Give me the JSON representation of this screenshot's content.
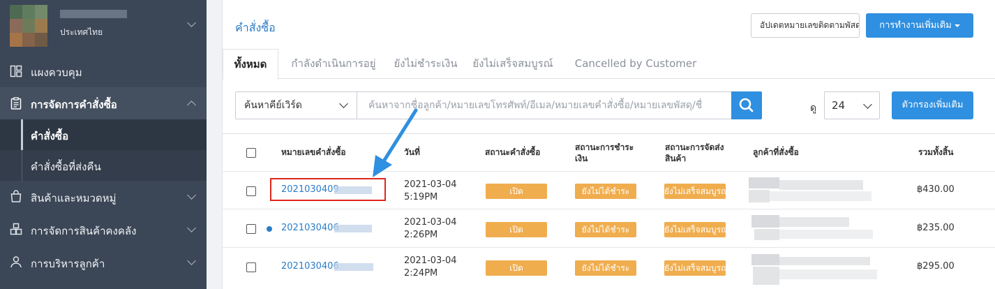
{
  "sidebar": {
    "store": {
      "country": "ประเทศไทย"
    },
    "items": [
      {
        "label": "แผงควบคุม"
      },
      {
        "label": "การจัดการคำสั่งซื้อ"
      },
      {
        "label": "คำสั่งซื้อ"
      },
      {
        "label": "คำสั่งซื้อที่ส่งคืน"
      },
      {
        "label": "สินค้าและหมวดหมู่"
      },
      {
        "label": "การจัดการสินค้าคงคลัง"
      },
      {
        "label": "การบริหารลูกค้า"
      }
    ]
  },
  "header": {
    "title": "คำสั่งซื้อ",
    "update_tracking_label": "อัปเดตหมายเลขติดตามพัสดุ",
    "more_actions_label": "การทำงานเพิ่มเติม"
  },
  "tabs": [
    {
      "label": "ทั้งหมด"
    },
    {
      "label": "กำลังดำเนินการอยู่"
    },
    {
      "label": "ยังไม่ชำระเงิน"
    },
    {
      "label": "ยังไม่เสร็จสมบูรณ์"
    },
    {
      "label": "Cancelled by Customer"
    }
  ],
  "search": {
    "type_label": "ค้นหาคีย์เวิร์ด",
    "placeholder": "ค้นหาจากชื่อลูกค้า/หมายเลขโทรศัพท์/อีเมล/หมายเลขคำสั่งซื้อ/หมายเลขพัสดุ/ชื่",
    "view_label": "ดู",
    "page_size": "24",
    "filter_label": "ตัวกรองเพิ่มเติม"
  },
  "table": {
    "columns": [
      "หมายเลขคำสั่งซื้อ",
      "วันที่",
      "สถานะคำสั่งซื้อ",
      "สถานะการชำระ",
      "เงิน",
      "สถานะการจัดส่ง",
      "สินค้า",
      "ลูกค้าที่สั่งซื้อ",
      "รวมทั้งสิ้น"
    ],
    "rows": [
      {
        "order": "2021030409",
        "date": "2021-03-04",
        "time": "5:19PM",
        "order_status": "เปิด",
        "payment_status": "ยังไม่ได้ชำระ",
        "shipping_status": "ยังไม่เสร็จสมบูรณ์",
        "total": "฿430.00"
      },
      {
        "order": "2021030406",
        "date": "2021-03-04",
        "time": "2:26PM",
        "order_status": "เปิด",
        "payment_status": "ยังไม่ได้ชำระ",
        "shipping_status": "ยังไม่เสร็จสมบูรณ์",
        "total": "฿235.00"
      },
      {
        "order": "2021030406",
        "date": "2021-03-04",
        "time": "2:24PM",
        "order_status": "เปิด",
        "payment_status": "ยังไม่ได้ชำระ",
        "shipping_status": "ยังไม่เสร็จสมบูรณ์",
        "total": "฿295.00"
      }
    ]
  },
  "colors": {
    "accent": "#2f8fe0",
    "link": "#2a7cc7",
    "badge": "#f0ad4e",
    "annotation_box": "#e0261b",
    "annotation_arrow": "#2f8fe0",
    "sidebar_bg": "#3b4656"
  }
}
